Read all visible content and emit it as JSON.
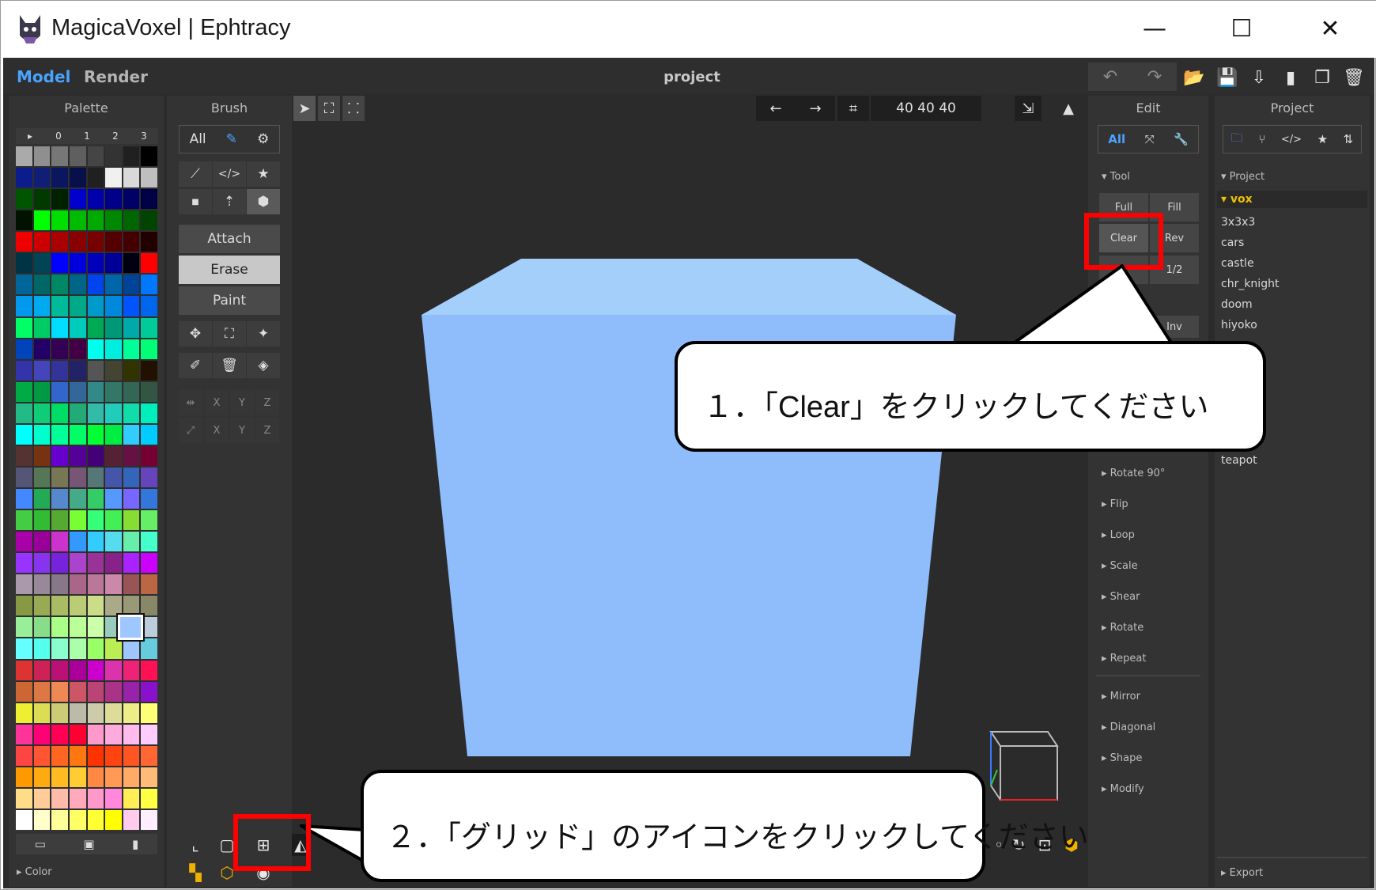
{
  "window": {
    "app_title": "MagicaVoxel | Ephtracy",
    "minimize": "—",
    "maximize": "☐",
    "close": "✕"
  },
  "modes": {
    "model": "Model",
    "render": "Render"
  },
  "project_title": "project",
  "palette": {
    "header": "Palette",
    "tabs": [
      "▸",
      "0",
      "1",
      "2",
      "3"
    ],
    "footer_label": "▸ Color",
    "rows": [
      [
        "#aaaaaa",
        "#8f8f8f",
        "#777777",
        "#5f5f5f",
        "#454545",
        "#333333",
        "#202020",
        "#000000"
      ],
      [
        "#0c1c8a",
        "#101e76",
        "#0a1660",
        "#071048",
        "#202020",
        "#f0f0f0",
        "#d9d9d9",
        "#bfbfbf"
      ],
      [
        "#005500",
        "#003a00",
        "#002200",
        "#0000cc",
        "#0000aa",
        "#000088",
        "#000066",
        "#000044"
      ],
      [
        "#001200",
        "#00ff00",
        "#00dd00",
        "#00bb00",
        "#00aa00",
        "#008800",
        "#006600",
        "#004400"
      ],
      [
        "#ee0000",
        "#cc0000",
        "#aa0000",
        "#880000",
        "#770000",
        "#550000",
        "#440000",
        "#220000"
      ],
      [
        "#003344",
        "#004455",
        "#0000ff",
        "#0000dd",
        "#0000bb",
        "#000099",
        "#000011",
        "#ff0000"
      ],
      [
        "#006699",
        "#006666",
        "#008866",
        "#006688",
        "#0044ee",
        "#0066aa",
        "#004499",
        "#0077ff"
      ],
      [
        "#0099ee",
        "#00aaee",
        "#00bb99",
        "#00aa88",
        "#0099cc",
        "#0088dd",
        "#0055ff",
        "#0066ee"
      ],
      [
        "#00ff66",
        "#00cc66",
        "#00ddff",
        "#00ccbb",
        "#00aa55",
        "#009977",
        "#00aaaa",
        "#00cc99"
      ],
      [
        "#0044bb",
        "#220066",
        "#330055",
        "#440044",
        "#00ffee",
        "#00eedd",
        "#00ff99",
        "#00ff77"
      ],
      [
        "#3333aa",
        "#4444bb",
        "#333399",
        "#222266",
        "#555555",
        "#444433",
        "#333300",
        "#221100"
      ],
      [
        "#00aa44",
        "#009944",
        "#3366cc",
        "#336699",
        "#338888",
        "#337766",
        "#336655",
        "#335544"
      ],
      [
        "#22bb88",
        "#11cc77",
        "#00dd66",
        "#22aa77",
        "#33bbaa",
        "#22ccbb",
        "#11ddaa",
        "#00eebb"
      ],
      [
        "#00ffff",
        "#00ffcc",
        "#00ff99",
        "#00ff66",
        "#00ff33",
        "#00ee44",
        "#33ccff",
        "#00ccff"
      ],
      [
        "#553333",
        "#773311",
        "#6600cc",
        "#550099",
        "#440077",
        "#552233",
        "#661144",
        "#770033"
      ],
      [
        "#555577",
        "#557755",
        "#777755",
        "#775577",
        "#557777",
        "#4455aa",
        "#3366bb",
        "#6644bb"
      ],
      [
        "#4488ff",
        "#22aa55",
        "#5588cc",
        "#44aa88",
        "#33cc66",
        "#5599ff",
        "#7766ff",
        "#3377dd"
      ],
      [
        "#44cc44",
        "#33bb33",
        "#55aa33",
        "#77ff33",
        "#33ff77",
        "#44ee55",
        "#88dd33",
        "#66ee66"
      ],
      [
        "#aa00aa",
        "#990099",
        "#cc33cc",
        "#3399ff",
        "#33ccff",
        "#55ddee",
        "#66eeaa",
        "#44ffcc"
      ],
      [
        "#9933ff",
        "#8833ee",
        "#7722dd",
        "#aa44cc",
        "#993399",
        "#882288",
        "#aa22ff",
        "#cc00ff"
      ],
      [
        "#aa99aa",
        "#998899",
        "#887788",
        "#aa6688",
        "#bb7799",
        "#cc88aa",
        "#995555",
        "#bb6644"
      ],
      [
        "#889944",
        "#99aa55",
        "#aabb66",
        "#bbcc77",
        "#ccdd88",
        "#aaaa88",
        "#999977",
        "#888866"
      ],
      [
        "#99ee99",
        "#88dd88",
        "#aaff88",
        "#bbff99",
        "#ccffaa",
        "#99ccbb",
        "#aabbcc",
        "#bbccdd"
      ],
      [
        "#66ffff",
        "#55ffee",
        "#88ffcc",
        "#aaffaa",
        "#99ff66",
        "#bbee55",
        "#9ec6ff",
        "#66ccdd"
      ],
      [
        "#dd3333",
        "#cc2255",
        "#bb1177",
        "#aa0099",
        "#cc00cc",
        "#dd33aa",
        "#ee2277",
        "#ff1155"
      ],
      [
        "#cc6633",
        "#dd7744",
        "#ee8855",
        "#cc5566",
        "#bb4477",
        "#aa3388",
        "#9922aa",
        "#8811cc"
      ],
      [
        "#eeee33",
        "#dddd55",
        "#cccc77",
        "#bbbbaa",
        "#ccccaa",
        "#dddd99",
        "#eeee88",
        "#ffff77"
      ],
      [
        "#ff3399",
        "#ff0077",
        "#ff0055",
        "#ff0033",
        "#ff99cc",
        "#ffaadd",
        "#ffbbee",
        "#ffccff"
      ],
      [
        "#ff4444",
        "#ff5533",
        "#ff6622",
        "#ff7711",
        "#ff3300",
        "#ff4411",
        "#ff5522",
        "#ff6633"
      ],
      [
        "#ff9900",
        "#ffaa11",
        "#ffbb22",
        "#ffcc33",
        "#ff8844",
        "#ff9955",
        "#ffaa66",
        "#ffbb77"
      ],
      [
        "#ffdd88",
        "#ffcc99",
        "#ffbbaa",
        "#ffaabb",
        "#ff99cc",
        "#ff88dd",
        "#ffee55",
        "#ffff44"
      ],
      [
        "#ffffff",
        "#ffffcc",
        "#ffff99",
        "#ffff66",
        "#ffff33",
        "#ffff00",
        "#ffccee",
        "#ffeeff"
      ]
    ]
  },
  "brush": {
    "header": "Brush",
    "all_label": "All",
    "attach": "Attach",
    "erase": "Erase",
    "paint": "Paint",
    "axes": [
      "X",
      "Y",
      "Z"
    ]
  },
  "viewport": {
    "size_readout": "40 40 40",
    "undo_arrow": "←",
    "redo_arrow": "→"
  },
  "edit": {
    "header": "Edit",
    "all_label": "All",
    "tool_label": "▾ Tool",
    "buttons": {
      "full": "Full",
      "fill": "Fill",
      "clear": "Clear",
      "rev": "Rev",
      "half": "1/2",
      "inv": "Inv"
    },
    "sections_a": [
      "▸ Rotate 90°",
      "▸ Flip",
      "▸ Loop",
      "▸ Scale",
      "▸ Shear",
      "▸ Rotate",
      "▸ Repeat"
    ],
    "sections_b": [
      "▸ Mirror",
      "▸ Diagonal",
      "▸ Shape",
      "▸ Modify"
    ]
  },
  "project_panel": {
    "header": "Project",
    "tree_label": "▾ Project",
    "selected": "▾ vox",
    "items": [
      "3x3x3",
      "cars",
      "castle",
      "chr_knight",
      "doom",
      "hiyoko"
    ],
    "last_item": "teapot",
    "footer_label": "▸ Export"
  },
  "callouts": {
    "step1": "１．「Clear」をクリックしてください",
    "step2": "２．「グリッド」のアイコンをクリックしてください"
  },
  "colors": {
    "accent": "#4aa3ff",
    "cube_front": "#8fbcfb",
    "cube_top": "#a4cffb",
    "highlight_red": "#ff0000",
    "icon_orange": "#f0b000"
  }
}
